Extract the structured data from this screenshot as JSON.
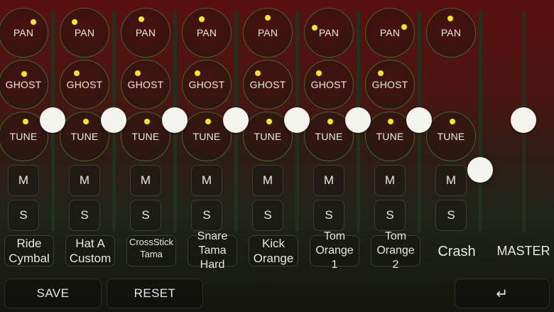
{
  "channels": [
    {
      "name": "Ride\nCymbal",
      "pan": "PAN",
      "ghost": "GHOST",
      "tune": "TUNE",
      "mute": "M",
      "solo": "S"
    },
    {
      "name": "Hat A\nCustom",
      "pan": "PAN",
      "ghost": "GHOST",
      "tune": "TUNE",
      "mute": "M",
      "solo": "S"
    },
    {
      "name": "CrossStick\nTama",
      "pan": "PAN",
      "ghost": "GHOST",
      "tune": "TUNE",
      "mute": "M",
      "solo": "S"
    },
    {
      "name": "Snare\nTama\nHard",
      "pan": "PAN",
      "ghost": "GHOST",
      "tune": "TUNE",
      "mute": "M",
      "solo": "S"
    },
    {
      "name": "Kick\nOrange",
      "pan": "PAN",
      "ghost": "GHOST",
      "tune": "TUNE",
      "mute": "M",
      "solo": "S"
    },
    {
      "name": "Tom\nOrange\n1",
      "pan": "PAN",
      "ghost": "GHOST",
      "tune": "TUNE",
      "mute": "M",
      "solo": "S"
    },
    {
      "name": "Tom\nOrange\n2",
      "pan": "PAN",
      "ghost": "GHOST",
      "tune": "TUNE",
      "mute": "M",
      "solo": "S"
    },
    {
      "name": "Crash",
      "pan": "PAN",
      "tune": "TUNE",
      "mute": "M",
      "solo": "S"
    }
  ],
  "master": {
    "label": "MASTER"
  },
  "buttons": {
    "save": "SAVE",
    "reset": "RESET",
    "enter_icon": "↵"
  },
  "colors": {
    "knob_dot": "#f2ea16",
    "knob_ring": "#3d6a2a",
    "fader_handle": "#f4f4ef"
  }
}
